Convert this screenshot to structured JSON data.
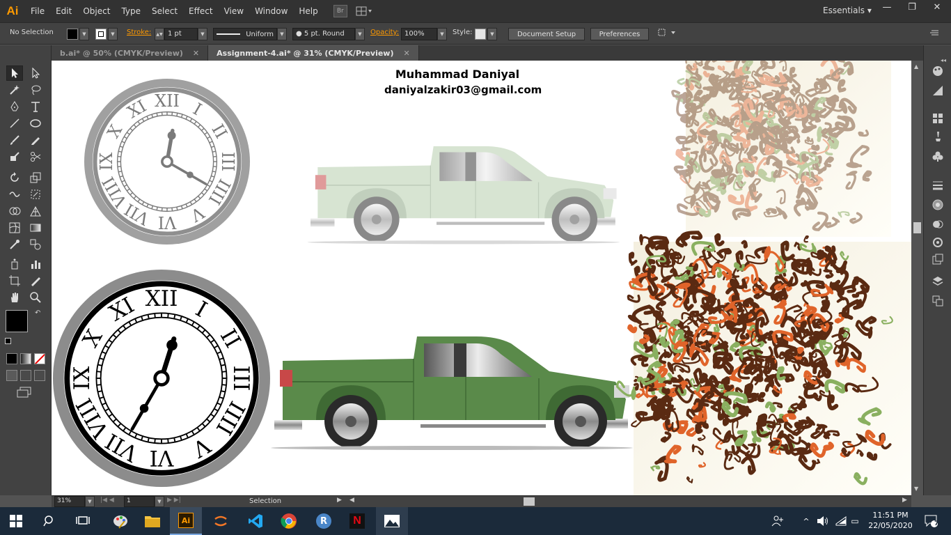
{
  "app": {
    "logo": "Ai"
  },
  "menu": [
    "File",
    "Edit",
    "Object",
    "Type",
    "Select",
    "Effect",
    "View",
    "Window",
    "Help"
  ],
  "bridge_label": "Br",
  "workspace": "Essentials",
  "control": {
    "selection": "No Selection",
    "stroke_label": "Stroke:",
    "stroke_value": "1 pt",
    "profile": "Uniform",
    "brush": "5 pt. Round",
    "opacity_label": "Opacity:",
    "opacity_value": "100%",
    "style_label": "Style:",
    "doc_setup": "Document Setup",
    "preferences": "Preferences"
  },
  "tabs": [
    {
      "label": "b.ai* @ 50% (CMYK/Preview)",
      "active": false
    },
    {
      "label": "Assignment-4.ai* @ 31% (CMYK/Preview)",
      "active": true
    }
  ],
  "artboard": {
    "author_name": "Muhammad Daniyal",
    "author_email": "daniyalzakir03@gmail.com"
  },
  "status": {
    "zoom": "31%",
    "page": "1",
    "tool": "Selection"
  },
  "clock": {
    "time": "11:51 PM",
    "date": "22/05/2020",
    "notifications": "7"
  },
  "colors": {
    "accent": "#ff9a00",
    "truck_green": "#5a8a4a",
    "truck_pale": "#a8c0a0",
    "swirl_brown": "#5a2a12",
    "swirl_orange": "#e0642a"
  }
}
